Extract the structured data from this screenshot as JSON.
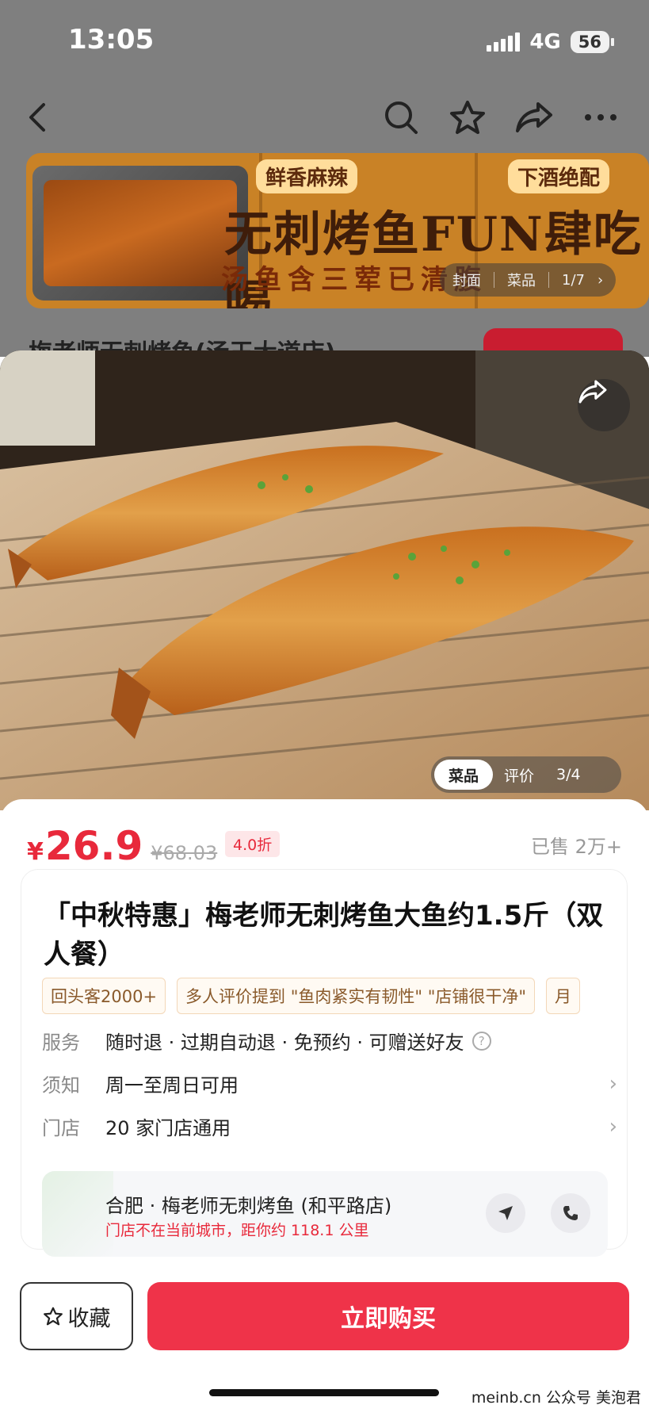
{
  "status_bar": {
    "time": "13:05",
    "network": "4G",
    "battery": "56"
  },
  "top_nav": {
    "icons": [
      "back-icon",
      "search-icon",
      "star-icon",
      "share-icon",
      "more-icon"
    ]
  },
  "banner": {
    "tag_left": "鲜香麻辣",
    "tag_right": "下酒绝配",
    "main_text": "无刺烤鱼FUN肆吃喝",
    "sub_text": "汤鱼含三荤已清腹",
    "pager": {
      "tab1": "封面",
      "tab2": "菜品",
      "index": "1/7"
    }
  },
  "title_peek": "梅老师无刺烤鱼(汤王大道店)",
  "photo": {
    "tabs": {
      "active": "菜品",
      "other": "评价",
      "index": "3/4"
    }
  },
  "price": {
    "symbol": "¥",
    "value": "26.9",
    "original": "¥68.03",
    "discount": "4.0折",
    "sold": "已售 2万+"
  },
  "product": {
    "title": "「中秋特惠」梅老师无刺烤鱼大鱼约1.5斤（双人餐）",
    "tags": [
      "回头客2000+",
      "多人评价提到 \"鱼肉紧实有韧性\" \"店铺很干净\"",
      "月"
    ]
  },
  "info": {
    "service_label": "服务",
    "service_value": "随时退 · 过期自动退 · 免预约 · 可赠送好友",
    "notice_label": "须知",
    "notice_value": "周一至周日可用",
    "store_label": "门店",
    "store_value": "20 家门店通用"
  },
  "store": {
    "name": "合肥 · 梅老师无刺烤鱼 (和平路店)",
    "distance": "门店不在当前城市，距你约 118.1 公里"
  },
  "bottom_bar": {
    "favorite_label": "收藏",
    "buy_label": "立即购买",
    "watermark": "meinb.cn  公众号 美泡君"
  },
  "colors": {
    "accent": "#ef3349",
    "price": "#e8293b"
  }
}
